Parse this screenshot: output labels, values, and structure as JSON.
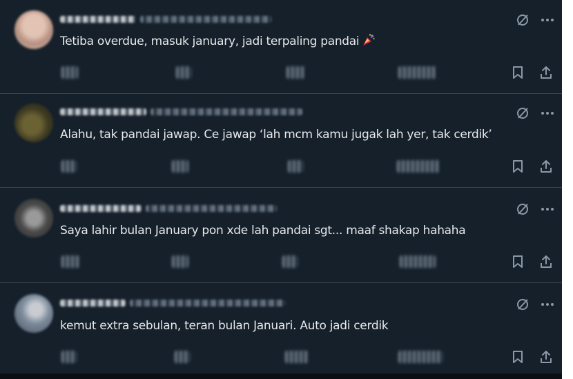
{
  "replies": [
    {
      "text": "Tetiba overdue, masuk january, jadi terpaling pandai",
      "emoji": "party-popper",
      "avatar_color": "#c9a89a"
    },
    {
      "text": "Alahu, tak pandai jawap. Ce jawap ‘lah mcm kamu jugak lah yer, tak cerdik’",
      "emoji": "",
      "avatar_color": "#4a4a2a"
    },
    {
      "text": "Saya lahir bulan January pon xde lah pandai sgt... maaf shakap hahaha",
      "emoji": "",
      "avatar_color": "#6b6b6b"
    },
    {
      "text": "kemut extra sebulan, teran bulan Januari. Auto jadi cerdik",
      "emoji": "",
      "avatar_color": "#5a6878"
    }
  ],
  "icons": {
    "grok": "grok-icon",
    "more": "more-icon",
    "reply": "reply-icon",
    "repost": "repost-icon",
    "like": "like-icon",
    "views": "views-icon",
    "bookmark": "bookmark-icon",
    "share": "share-icon"
  },
  "colors": {
    "background": "#15202b",
    "text": "#e7e9ea",
    "muted": "#8b98a5",
    "divider": "#38444d"
  }
}
